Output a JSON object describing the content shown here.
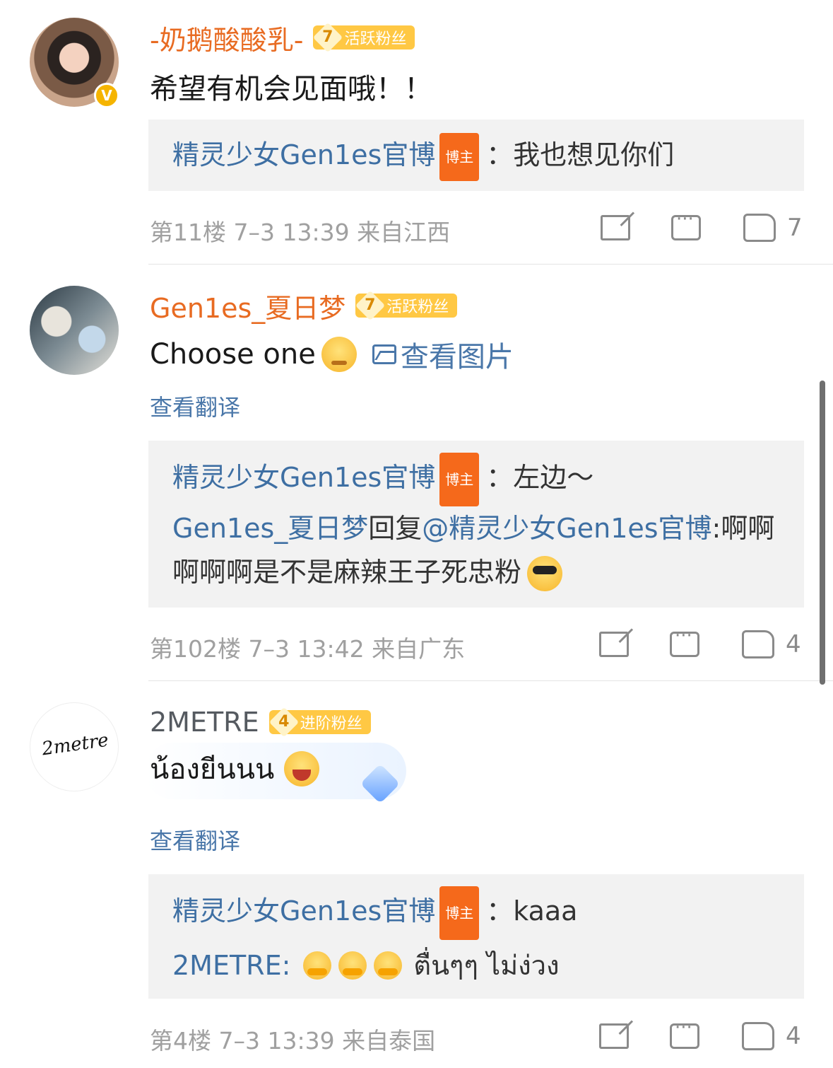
{
  "comments": [
    {
      "username": "-奶鹅酸酸乳-",
      "fan_level": "7",
      "fan_label": "活跃粉丝",
      "verified": true,
      "text": "希望有机会见面哦！！",
      "replies": [
        {
          "name": "精灵少女Gen1es官博",
          "badge": "博主",
          "text": "：我也想见你们"
        }
      ],
      "floor": "第11楼",
      "time": "7–3 13:39",
      "location": "来自江西",
      "likes": "7"
    },
    {
      "username": "Gen1es_夏日梦",
      "fan_level": "7",
      "fan_label": "活跃粉丝",
      "text": "Choose one",
      "emoji": "thinking-face",
      "view_image": "查看图片",
      "translate": "查看翻译",
      "replies": [
        {
          "name": "精灵少女Gen1es官博",
          "badge": "博主",
          "text": "：左边～"
        },
        {
          "name": "Gen1es_夏日梦",
          "reply_word": "回复",
          "mention": "@精灵少女Gen1es官博",
          "text": ":啊啊啊啊啊是不是麻辣王子死忠粉",
          "emoji": "sunglasses-face"
        }
      ],
      "floor": "第102楼",
      "time": "7–3 13:42",
      "location": "来自广东",
      "likes": "4"
    },
    {
      "username": "2METRE",
      "fan_level": "4",
      "fan_label": "进阶粉丝",
      "avatar_text": "2metre",
      "text": "น้องยีนนน",
      "emoji": "laughing-face",
      "translate": "查看翻译",
      "replies": [
        {
          "name": "精灵少女Gen1es官博",
          "badge": "博主",
          "text": "：kaaa"
        },
        {
          "name": "2METRE:",
          "emojis": "hugging-face x3",
          "text": "ตื่นๆๆ ไม่ง่วง"
        }
      ],
      "floor": "第4楼",
      "time": "7–3 13:39",
      "location": "来自泰国",
      "likes": "4"
    }
  ],
  "colors": {
    "username": "#e86b22",
    "link": "#3e6fa3",
    "meta": "#a0a0a0",
    "reply_bg": "#f2f2f2"
  }
}
